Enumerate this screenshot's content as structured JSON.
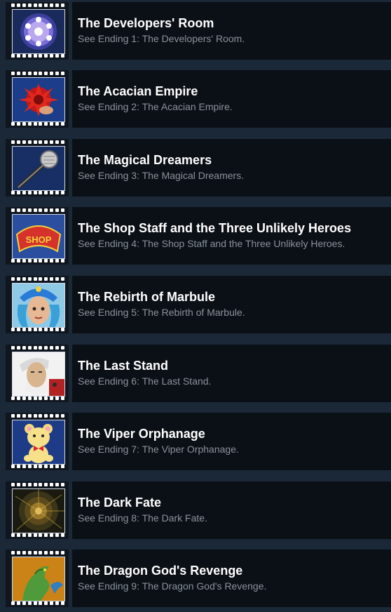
{
  "achievements": [
    {
      "title": "The Developers' Room",
      "description": "See Ending 1: The Developers' Room.",
      "icon": "glowing-orb-icon"
    },
    {
      "title": "The Acacian Empire",
      "description": "See Ending 2: The Acacian Empire.",
      "icon": "red-flame-crest-icon"
    },
    {
      "title": "The Magical Dreamers",
      "description": "See Ending 3: The Magical Dreamers.",
      "icon": "microphone-icon"
    },
    {
      "title": "The Shop Staff and the Three Unlikely Heroes",
      "description": "See Ending 4: The Shop Staff and the Three Unlikely Heroes.",
      "icon": "shop-sign-icon",
      "sign_text": "SHOP"
    },
    {
      "title": "The Rebirth of Marbule",
      "description": "See Ending 5: The Rebirth of Marbule.",
      "icon": "jester-portrait-icon"
    },
    {
      "title": "The Last Stand",
      "description": "See Ending 6: The Last Stand.",
      "icon": "old-man-portrait-icon"
    },
    {
      "title": "The Viper Orphanage",
      "description": "See Ending 7: The Viper Orphanage.",
      "icon": "teddy-bear-icon"
    },
    {
      "title": "The Dark Fate",
      "description": "See Ending 8: The Dark Fate.",
      "icon": "dark-vortex-icon"
    },
    {
      "title": "The Dragon God's Revenge",
      "description": "See Ending 9: The Dragon God's Revenge.",
      "icon": "dragon-icon"
    }
  ],
  "colors": {
    "page_bg": "#1b2838",
    "row_bg": "#0b1016",
    "title": "#ffffff",
    "description": "#8b929a"
  }
}
